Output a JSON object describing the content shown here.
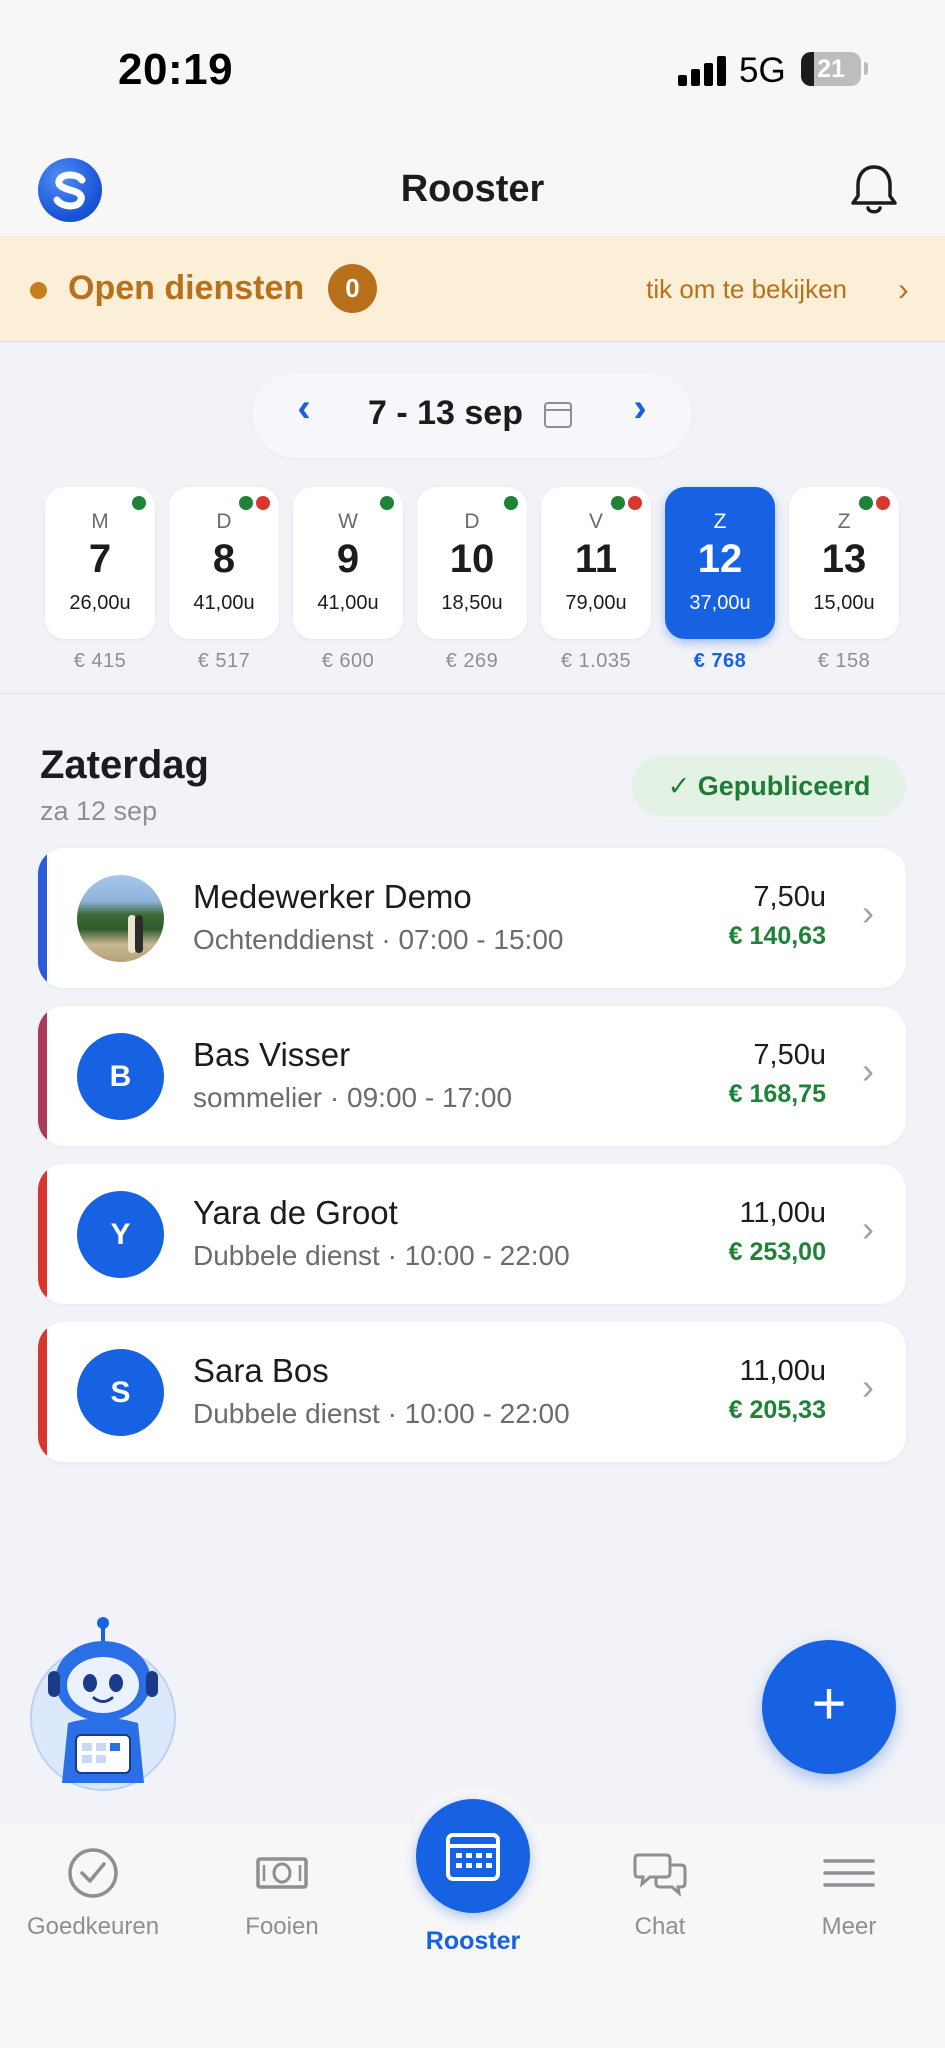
{
  "status_bar": {
    "time": "20:19",
    "network": "5G",
    "battery": "21",
    "battery_level": 0.21
  },
  "header": {
    "title": "Rooster",
    "logo_icon": "s-logo-icon",
    "bell_icon": "bell-icon"
  },
  "open_shifts": {
    "title": "Open diensten",
    "count": "0",
    "link_text": "tik om te bekijken",
    "chevron": "›"
  },
  "week": {
    "prev": "‹",
    "range": "7 - 13 sep",
    "next": "›",
    "calendar_icon": "calendar-icon"
  },
  "days": [
    {
      "letter": "M",
      "number": "7",
      "hours": "26,00u",
      "cost": "€ 415",
      "dots": [
        "#1e8237"
      ],
      "selected": false
    },
    {
      "letter": "D",
      "number": "8",
      "hours": "41,00u",
      "cost": "€ 517",
      "dots": [
        "#1e8237",
        "#d8372f"
      ],
      "selected": false
    },
    {
      "letter": "W",
      "number": "9",
      "hours": "41,00u",
      "cost": "€ 600",
      "dots": [
        "#1e8237"
      ],
      "selected": false
    },
    {
      "letter": "D",
      "number": "10",
      "hours": "18,50u",
      "cost": "€ 269",
      "dots": [
        "#1e8237"
      ],
      "selected": false
    },
    {
      "letter": "V",
      "number": "11",
      "hours": "79,00u",
      "cost": "€ 1.035",
      "dots": [
        "#1e8237",
        "#d8372f"
      ],
      "selected": false
    },
    {
      "letter": "Z",
      "number": "12",
      "hours": "37,00u",
      "cost": "€ 768",
      "dots": [],
      "selected": true
    },
    {
      "letter": "Z",
      "number": "13",
      "hours": "15,00u",
      "cost": "€ 158",
      "dots": [
        "#1e8237",
        "#d8372f"
      ],
      "selected": false
    }
  ],
  "day_section": {
    "title": "Zaterdag",
    "subtitle": "za 12 sep",
    "status": "✓ Gepubliceerd"
  },
  "shifts": [
    {
      "name": "Medewerker Demo",
      "detail": "Ochtenddienst · 07:00 - 15:00",
      "hours": "7,50u",
      "pay": "€ 140,63",
      "initial": "",
      "accent": "#2c5bd6",
      "photo": true,
      "chevron": "›"
    },
    {
      "name": "Bas Visser",
      "detail": "sommelier · 09:00 - 17:00",
      "hours": "7,50u",
      "pay": "€ 168,75",
      "initial": "B",
      "accent": "#a93a5c",
      "photo": false,
      "chevron": "›"
    },
    {
      "name": "Yara de Groot",
      "detail": "Dubbele dienst · 10:00 - 22:00",
      "hours": "11,00u",
      "pay": "€ 253,00",
      "initial": "Y",
      "accent": "#d8372f",
      "photo": false,
      "chevron": "›"
    },
    {
      "name": "Sara Bos",
      "detail": "Dubbele dienst · 10:00 - 22:00",
      "hours": "11,00u",
      "pay": "€ 205,33",
      "initial": "S",
      "accent": "#d8372f",
      "photo": false,
      "chevron": "›"
    }
  ],
  "fab": {
    "label": "+"
  },
  "tabs": [
    {
      "label": "Goedkeuren",
      "icon": "check-circle-icon"
    },
    {
      "label": "Fooien",
      "icon": "banknote-icon"
    },
    {
      "label": "Rooster",
      "icon": "calendar-grid-icon",
      "active": true
    },
    {
      "label": "Chat",
      "icon": "chat-bubbles-icon"
    },
    {
      "label": "Meer",
      "icon": "menu-icon"
    }
  ],
  "colors": {
    "accent": "#1662e3",
    "open_shifts": "#b8711a",
    "pay_green": "#1e8237",
    "published_bg": "#e3f2e4"
  }
}
